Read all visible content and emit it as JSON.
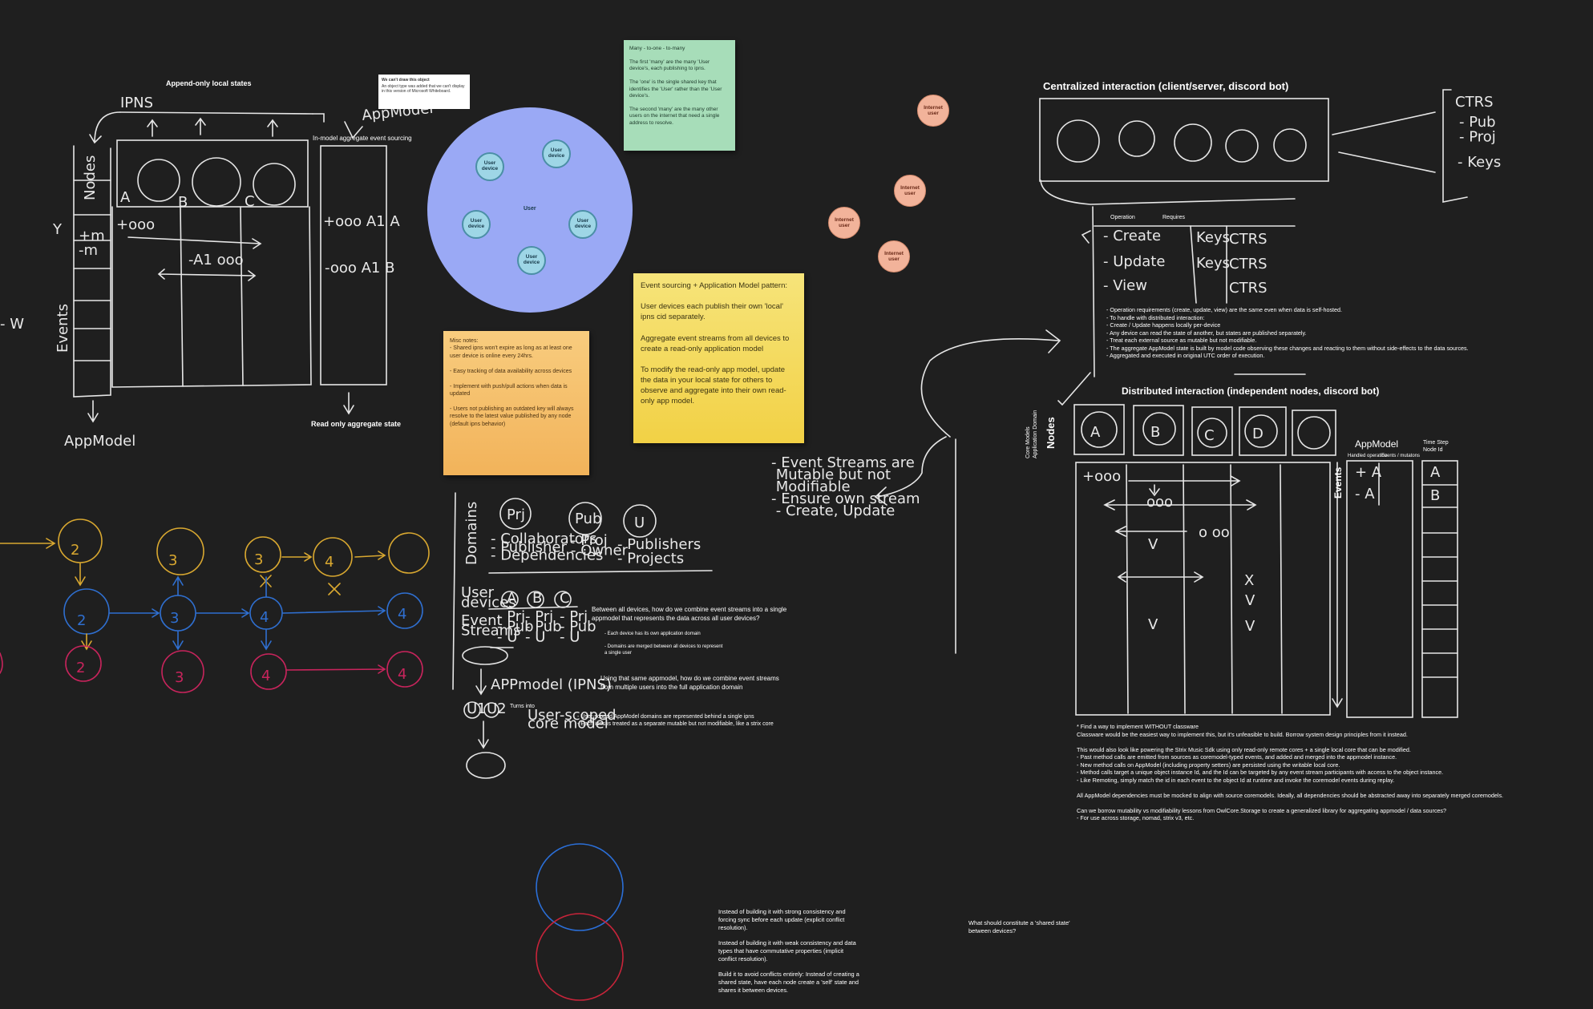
{
  "labels": {
    "append_only": "Append-only local states",
    "in_model": "In-model aggregate event sourcing",
    "read_only": "Read only aggregate state",
    "centralized": "Centralized interaction (client/server, discord bot)",
    "distributed": "Distributed interaction (independent nodes, discord bot)",
    "operation": "Operation",
    "requires": "Requires",
    "appmodel": "AppModel",
    "time_step": "Time Step\nNode Id",
    "nodes": "Nodes",
    "events": "Events",
    "core_models": "Core Models\nApplication Domain",
    "handled_op": "Handled operation",
    "events_mut": "Events / mutatons",
    "user": "User"
  },
  "tiny_note": {
    "title": "We can't draw this object",
    "body": "An object type was added that we can't display in this version of Microsoft Whiteboard."
  },
  "sticky_green": "Many - to-one - to-many\n\nThe first 'many' are the many 'User device's, each publishing to ipns.\n\nThe 'one' is the single shared key that identifies the 'User' rather than the 'User device's.\n\nThe second 'many' are the many other users on the internet that need a single address to resolve.",
  "sticky_yellow": "Event sourcing + Application Model pattern:\n\nUser devices each publish their own 'local' ipns cid separately.\n\nAggregate event streams from all devices to create a read-only application model\n\nTo modify the read-only app model, update the data in your local state for others to observe and aggregate into their own read-only app model.",
  "sticky_orange": "Misc notes:\n- Shared ipns won't expire as long as at least one user device is online every 24hrs.\n\n- Easy tracking of data availability across devices\n\n- Implement with push/pull actions when data is updated\n\n- Users not publishing an outdated key will always resolve to the latest value published by any node (default ipns behavior)",
  "user_devices": [
    "User\ndevice",
    "User\ndevice",
    "User\ndevice",
    "User\ndevice",
    "User\ndevice"
  ],
  "internet_users": [
    "Internet\nuser",
    "Internet\nuser",
    "Internet\nuser",
    "Internet\nuser"
  ],
  "notes": {
    "combine": "Between all devices, how do we combine event streams into a single appmodel that represents the data across all user devices?",
    "combine_bullets": "- Each device has its own application domain\n\n- Domains are merged between all devices to represent a single user",
    "same_appmodel": "Using that same appmodel, how do we combine event streams from multiple users into the full application domain",
    "turns_into": "Turns into",
    "user_scoped": "- User-scoped AppModel domains are represented behind a single ipns\n- Each ipns is treated as a separate mutable but not modifiable, like a strix core",
    "ops": "- Operation requirements (create, update, view) are the same even when data is self-hosted.\n- To handle with distributed interaction:\n  - Create / Update happens locally per-device\n  - Any device can read the state of another, but states are published separately.\n- Treat each external source as mutable but not modifiable.\n- The aggregate AppModel state is built by model code observing these changes and reacting to them without side-effects to the data sources.\n- Aggregated and executed in original UTC order of execution.",
    "classware": "* Find a way to implement WITHOUT classware\n  Classware would be the easiest way to implement this, but it's unfeasible to build. Borrow system design principles from it instead.\n\n  This would also look like powering the Strix Music Sdk using only read-only remote cores + a single local core that can be modified.\n   - Past method calls are emitted from sources as coremodel-typed events, and added and merged into the appmodel instance.\n   - New method calls on AppModel (including property setters) are persisted using the writable local core.\n   - Method calls target a unique object instance Id, and the Id can be targeted by any event stream participants with access to the object instance.\n   - Like Remoting, simply match the id in each event to the object Id at runtime and invoke the coremodel events during replay.\n\nAll AppModel dependencies must be mocked to align with source coremodels. Ideally, all dependencies should be abstracted away into separately merged coremodels.\n\n  Can we borrow mutability vs modifiability lessons from OwlCore.Storage to create a generalized library for aggregating appmodel / data sources?\n   - For use across storage, nomad, strix v3, etc.",
    "strong": "Instead of building it with strong consistency and forcing sync before each update (explicit conflict resolution).\n\nInstead of building it with weak consistency and data types that have commutative properties (implicit conflict resolution).\n\nBuild it to avoid conflicts entirely: Instead of creating a shared state, have each node create a 'self' state and shares it between devices.",
    "shared_state": "What should constitute a 'shared state' between devices?"
  },
  "handwriting": {
    "ipns": "IPNS",
    "appmodel_top": "AppModel",
    "nodes": "Nodes",
    "events": "Events",
    "appmodel_bottom": "AppModel",
    "a": "A",
    "b": "B",
    "c": "C",
    "d": "D",
    "t000": "+ooo",
    "tm1": "+m",
    "tm2": "-m",
    "a1_000": "-A1 ooo",
    "plus_a1a": "+ooo A1 A",
    "minus_a1b": "-ooo A1 B",
    "w": "- W",
    "y": "Y",
    "two": "2",
    "three": "3",
    "four": "4",
    "x": "X",
    "domains": "Domains",
    "prj": "Prj",
    "pub": "Pub",
    "u": "U",
    "collab": "- Collaborators\n- Publisher\n- Dependencies",
    "proj_owner": "- Proj\n- Owner",
    "publishers": "- Publishers\n- Projects",
    "user_devices": "User\ndevices",
    "event_streams": "Event\nStreams",
    "col_a": "- Prj\n- Pub\n- U",
    "col_b": "- Prj\n- Pub\n- U",
    "col_c": "- Prj\n- Pub\n- U",
    "appmodel_ipns": "APPmodel (IPNS)",
    "u1": "U1",
    "u2": "U2",
    "user_scoped_hw": "User-scoped\ncore model",
    "event_streams_note": "- Event Streams are\n  Mutable but not\n  Modifiable\n- Ensure own stream\n  - Create, Update",
    "ctrs": "CTRS",
    "pub_proj": "- Pub\n- Proj",
    "keys": "- Keys",
    "create": "- Create",
    "update": "- Update",
    "view": "- View",
    "keys2": "Keys",
    "ctrs2": "CTRS",
    "plus_a": "+ A",
    "minus_a": "- A",
    "dots": "ooo",
    "b_col": "B",
    "a_col": "A",
    "v": "V",
    "dots2": "o oo",
    "dots3": "- o oo"
  }
}
